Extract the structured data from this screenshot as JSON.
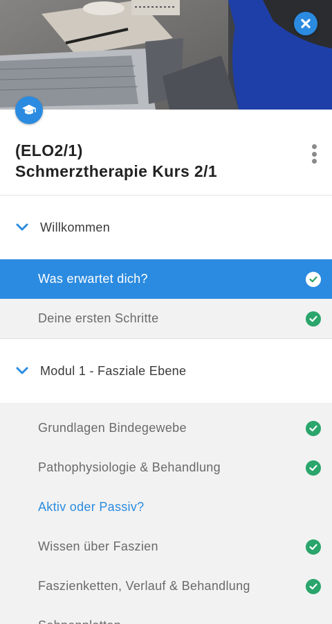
{
  "colors": {
    "accent": "#2b8be0",
    "check": "#2aa56b"
  },
  "header": {
    "close_icon": "close-icon",
    "badge_icon": "graduation-cap-icon",
    "title_line1": "(ELO2/1)",
    "title_line2": "Schmerztherapie Kurs 2/1",
    "menu_icon": "more-vertical-icon"
  },
  "sections": [
    {
      "label": "Willkommen",
      "expanded": true,
      "items": [
        {
          "label": "Was erwartet dich?",
          "state": "active",
          "completed": true
        },
        {
          "label": "Deine ersten Schritte",
          "state": "normal",
          "completed": true
        }
      ]
    },
    {
      "label": "Modul 1 - Fasziale Ebene",
      "expanded": true,
      "items": [
        {
          "label": "Grundlagen Bindegewebe",
          "state": "normal",
          "completed": true
        },
        {
          "label": "Pathophysiologie & Behandlung",
          "state": "normal",
          "completed": true
        },
        {
          "label": "Aktiv oder Passiv?",
          "state": "current",
          "completed": false
        },
        {
          "label": "Wissen über Faszien",
          "state": "normal",
          "completed": true
        },
        {
          "label": "Faszienketten, Verlauf & Behandlung",
          "state": "normal",
          "completed": true
        },
        {
          "label": "Sehnenplatten",
          "state": "normal",
          "completed": false
        }
      ]
    }
  ]
}
